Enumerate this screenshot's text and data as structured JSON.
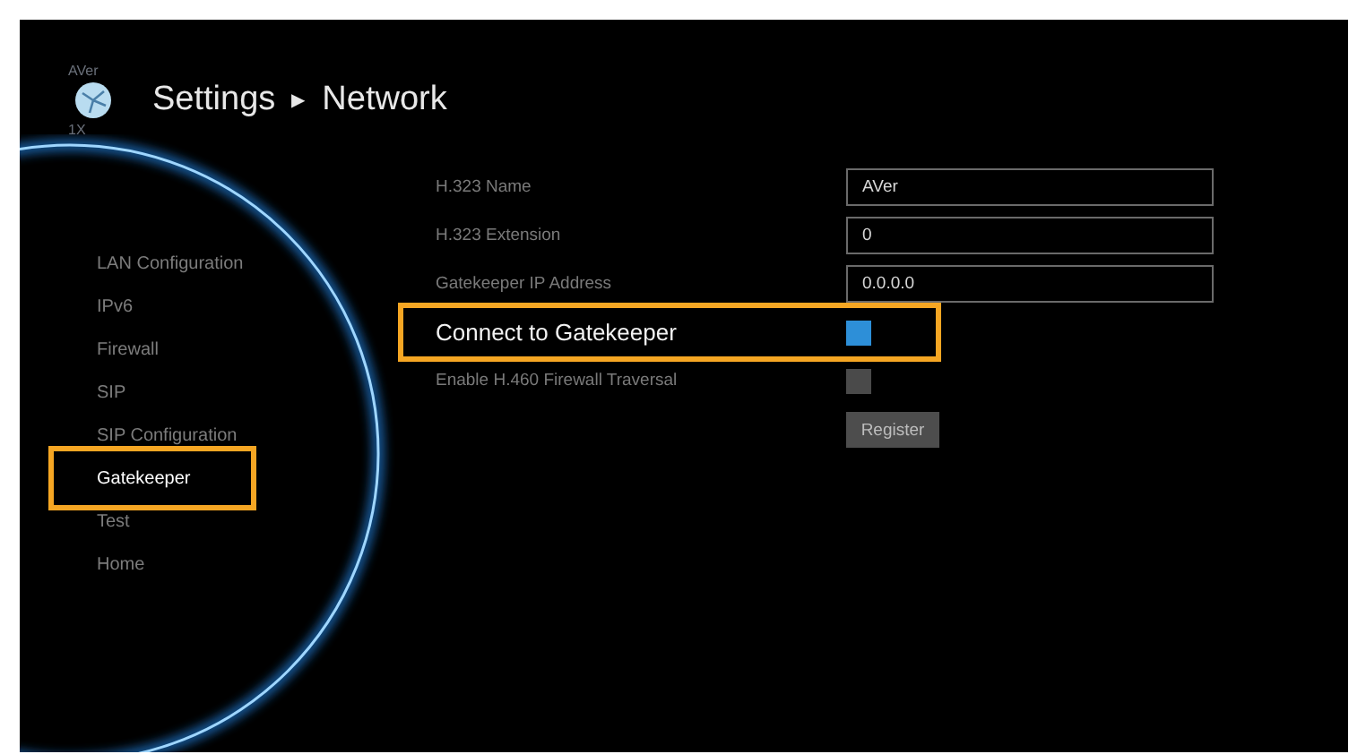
{
  "logo": {
    "top_text": "AVer",
    "bottom_text": "1X"
  },
  "breadcrumb": {
    "parent": "Settings",
    "separator": "▶",
    "current": "Network"
  },
  "sidebar": {
    "items": [
      {
        "label": "LAN Configuration",
        "selected": false
      },
      {
        "label": "IPv6",
        "selected": false
      },
      {
        "label": "Firewall",
        "selected": false
      },
      {
        "label": "SIP",
        "selected": false
      },
      {
        "label": "SIP Configuration",
        "selected": false
      },
      {
        "label": "Gatekeeper",
        "selected": true
      },
      {
        "label": "Test",
        "selected": false
      },
      {
        "label": "Home",
        "selected": false
      }
    ]
  },
  "form": {
    "fields": [
      {
        "kind": "text",
        "label": "H.323 Name",
        "value": "AVer",
        "highlighted": false
      },
      {
        "kind": "text",
        "label": "H.323 Extension",
        "value": "0",
        "highlighted": false
      },
      {
        "kind": "text",
        "label": "Gatekeeper IP Address",
        "value": "0.0.0.0",
        "highlighted": false
      },
      {
        "kind": "checkbox",
        "label": "Connect to Gatekeeper",
        "checked": true,
        "highlighted": true
      },
      {
        "kind": "checkbox",
        "label": "Enable H.460 Firewall Traversal",
        "checked": false,
        "highlighted": false
      }
    ],
    "button": "Register"
  }
}
